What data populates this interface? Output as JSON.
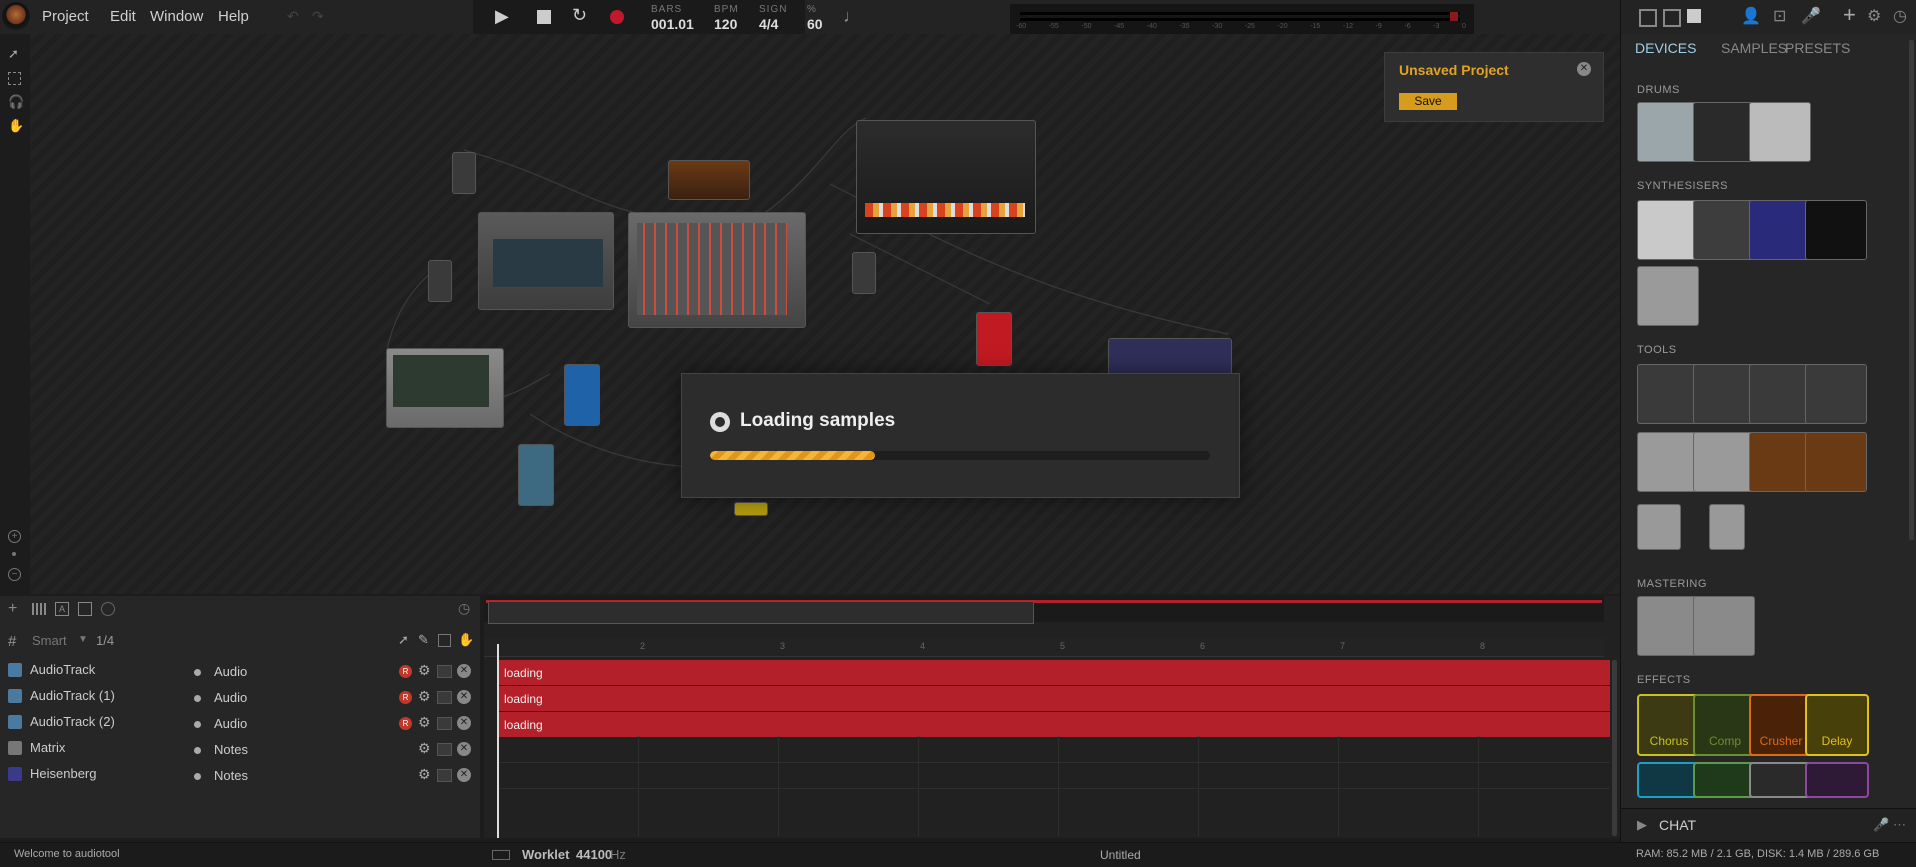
{
  "menu": {
    "items": [
      "Project",
      "Edit",
      "Window",
      "Help"
    ]
  },
  "transport": {
    "bars_label": "BARS",
    "bars_value": "001.01",
    "bpm_label": "BPM",
    "bpm_value": "120",
    "sign_label": "SIGN",
    "sign_value": "4/4",
    "pct_label": "%",
    "pct_value": "60"
  },
  "meter": {
    "ticks": [
      "-60",
      "-55",
      "-50",
      "-45",
      "-40",
      "-35",
      "-30",
      "-25",
      "-20",
      "-15",
      "-12",
      "-9",
      "-6",
      "-3",
      "0"
    ]
  },
  "project": {
    "unsaved_title": "Unsaved Project",
    "save_label": "Save"
  },
  "loading": {
    "title": "Loading samples",
    "progress": 0.33
  },
  "panel": {
    "tabs": [
      "DEVICES",
      "SAMPLES",
      "PRESETS"
    ],
    "active_tab": "DEVICES",
    "sections": {
      "drums": "DRUMS",
      "synthesisers": "SYNTHESISERS",
      "tools": "TOOLS",
      "mastering": "MASTERING",
      "effects": "EFFECTS"
    },
    "effects": [
      {
        "label": "Chorus",
        "color": "#c9c21d"
      },
      {
        "label": "Comp",
        "color": "#6a8f2c"
      },
      {
        "label": "Crusher",
        "color": "#e06a12"
      },
      {
        "label": "Delay",
        "color": "#e0c01a"
      }
    ],
    "chat_label": "CHAT"
  },
  "sequencer": {
    "mode_label": "Smart",
    "quantize": "1/4",
    "tracks": [
      {
        "name": "AudioTrack",
        "type": "Audio",
        "region": "loading"
      },
      {
        "name": "AudioTrack (1)",
        "type": "Audio",
        "region": "loading"
      },
      {
        "name": "AudioTrack (2)",
        "type": "Audio",
        "region": "loading"
      },
      {
        "name": "Matrix",
        "type": "Notes"
      },
      {
        "name": "Heisenberg",
        "type": "Notes"
      }
    ],
    "ruler": [
      "1",
      "2",
      "3",
      "4",
      "5",
      "6",
      "7",
      "8"
    ]
  },
  "status": {
    "welcome": "Welcome to audiotool",
    "engine": "Worklet",
    "samplerate": "44100",
    "samplerate_unit": "Hz",
    "doc_title": "Untitled",
    "resources": "RAM: 85.2 MB / 2.1 GB, DISK: 1.4 MB / 289.6 GB"
  },
  "colors": {
    "accent": "#e2a324",
    "region": "#b3202a",
    "tab_active": "#9ecfe6"
  }
}
